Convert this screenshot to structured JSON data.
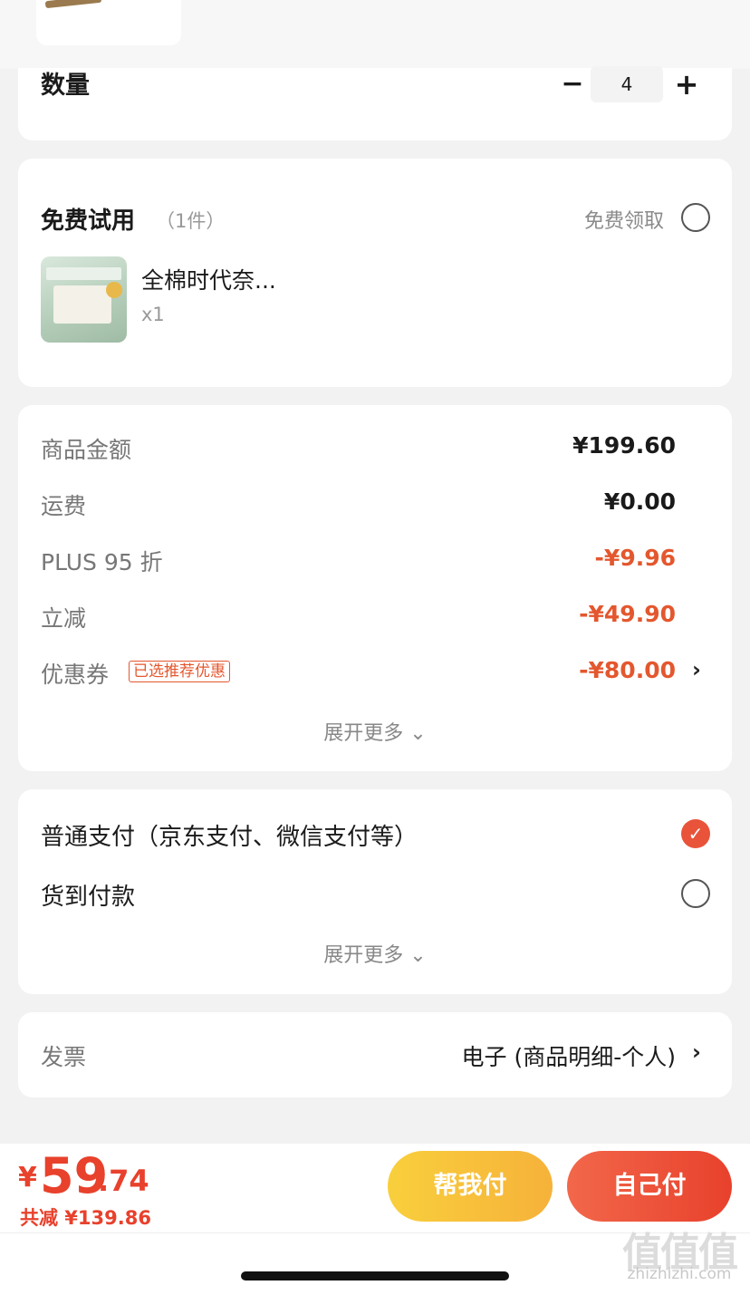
{
  "quantity": {
    "label": "数量",
    "minus": "−",
    "value": "4",
    "plus": "+"
  },
  "free_trial": {
    "title": "免费试用",
    "count": "（1件）",
    "claim_label": "免费领取",
    "product_name": "全棉时代奈...",
    "product_qty": "x1"
  },
  "summary": {
    "rows": [
      {
        "label": "商品金额",
        "value": "¥199.60"
      },
      {
        "label": "运费",
        "value": "¥0.00"
      },
      {
        "label": "PLUS 95 折",
        "value": "-¥9.96"
      },
      {
        "label": "立减",
        "value": "-¥49.90"
      },
      {
        "label": "优惠券",
        "value": "-¥80.00",
        "tag": "已选推荐优惠"
      }
    ],
    "expand_label": "展开更多 ⌄"
  },
  "payment": {
    "options": [
      {
        "label": "普通支付（京东支付、微信支付等）",
        "selected": true
      },
      {
        "label": "货到付款",
        "selected": false
      }
    ],
    "expand_label": "展开更多 ⌄"
  },
  "invoice": {
    "label": "发票",
    "value": "电子 (商品明细-个人)"
  },
  "bottom": {
    "currency": "¥",
    "price_int": "59",
    "price_dec": ".74",
    "saved": "共减 ¥139.86",
    "help_pay": "帮我付",
    "self_pay": "自己付"
  },
  "watermark": {
    "glyphs": "值值值",
    "text": "zhizhizhi.com"
  },
  "colors": {
    "accent_red": "#e8412c",
    "discount_red": "#e4572e",
    "help_yellow": "#f6b23a"
  },
  "icons": {
    "minus": "minus-icon",
    "plus": "plus-icon",
    "chevron": "chevron-right-icon",
    "check": "check-icon"
  }
}
